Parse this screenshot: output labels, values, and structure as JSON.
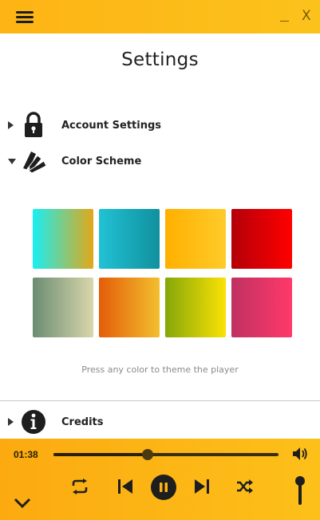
{
  "window": {
    "menu_icon": "hamburger-menu-icon",
    "minimize_label": "_",
    "close_label": "X"
  },
  "page": {
    "title": "Settings"
  },
  "sections": [
    {
      "label": "Account Settings",
      "icon": "lock-icon",
      "expanded": false
    },
    {
      "label": "Color Scheme",
      "icon": "color-palette-icon",
      "expanded": true
    },
    {
      "label": "Credits",
      "icon": "info-icon",
      "expanded": false
    }
  ],
  "color_scheme": {
    "swatches": [
      {
        "name": "cyan-gold",
        "from": "#19eef3",
        "to": "#e2a818"
      },
      {
        "name": "teal",
        "from": "#21c2d4",
        "to": "#10909e"
      },
      {
        "name": "amber",
        "from": "#ffb000",
        "to": "#ffcb2a"
      },
      {
        "name": "crimson",
        "from": "#b30009",
        "to": "#ff0000"
      },
      {
        "name": "sage",
        "from": "#6b8d72",
        "to": "#d9d6ac"
      },
      {
        "name": "orange",
        "from": "#e35d09",
        "to": "#f3bf2d"
      },
      {
        "name": "lime",
        "from": "#85a70a",
        "to": "#fbe204"
      },
      {
        "name": "rose",
        "from": "#bf3163",
        "to": "#ff3969"
      }
    ],
    "hint": "Press any color to theme the player"
  },
  "player": {
    "elapsed": "01:38",
    "progress": 0.42,
    "volume": 0.85,
    "accent_color": "#fdb414"
  }
}
